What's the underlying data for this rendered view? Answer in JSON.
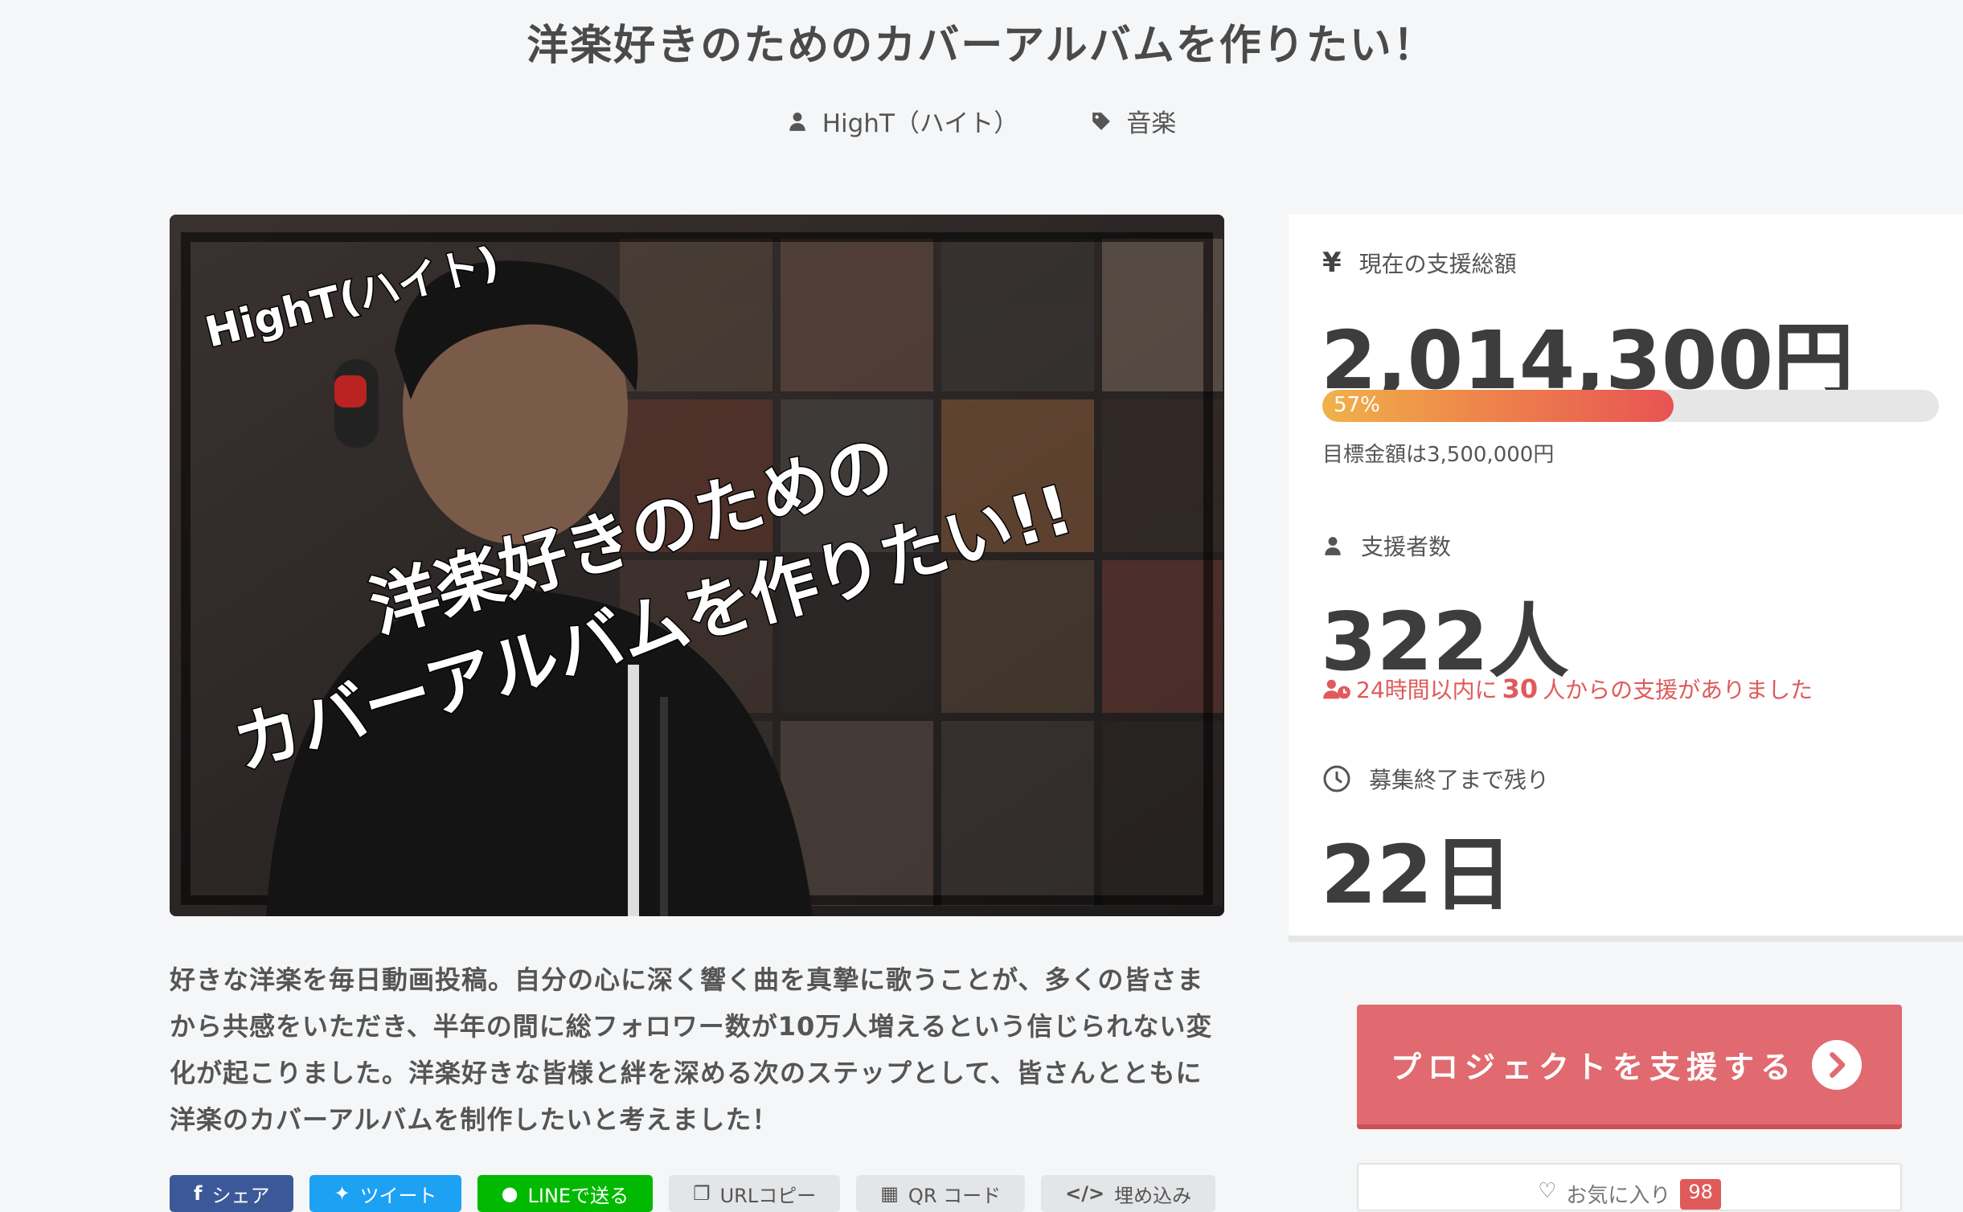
{
  "page": {
    "title": "洋楽好きのためのカバーアルバムを作りたい！",
    "author": "HighT（ハイト）",
    "category": "音楽"
  },
  "hero": {
    "badge": "HighT(ハイト)",
    "headline_line1": "洋楽好きのための",
    "headline_line2": "カバーアルバムを作りたい!!"
  },
  "description": "好きな洋楽を毎日動画投稿。自分の心に深く響く曲を真摯に歌うことが、多くの皆さまから共感をいただき、半年の間に総フォロワー数が10万人増えるという信じられない変化が起こりました。洋楽好きな皆様と絆を深める次のステップとして、皆さんとともに洋楽のカバーアルバムを制作したいと考えました！",
  "share": {
    "facebook": "シェア",
    "twitter": "ツイート",
    "line": "LINEで送る",
    "url_copy": "URLコピー",
    "qr": "QR コード",
    "embed": "埋め込み"
  },
  "stats": {
    "amount_label": "現在の支援総額",
    "amount": "2,014,300円",
    "progress_label": "57%",
    "progress_value": 0.57,
    "goal": "目標金額は3,500,000円",
    "supporters_label": "支援者数",
    "supporters": "322人",
    "recent_prefix": "24時間以内に",
    "recent_count": "30",
    "recent_suffix": "人からの支援がありました",
    "remaining_label": "募集終了まで残り",
    "remaining": "22日"
  },
  "actions": {
    "support_button": "プロジェクトを支援する",
    "favorite_label": "お気に入り",
    "favorite_count": "98"
  },
  "colors": {
    "accent": "#e06a6f",
    "alert": "#e05a5a",
    "facebook": "#3b5998",
    "twitter": "#1da1f2",
    "line": "#00b900"
  },
  "icons": {
    "author": "user-icon",
    "category": "tag-icon",
    "amount": "yen-icon",
    "supporters": "user-icon",
    "recent": "user-clock-icon",
    "remaining": "clock-icon",
    "support": "chevron-right-circle-icon",
    "favorite": "heart-icon"
  }
}
